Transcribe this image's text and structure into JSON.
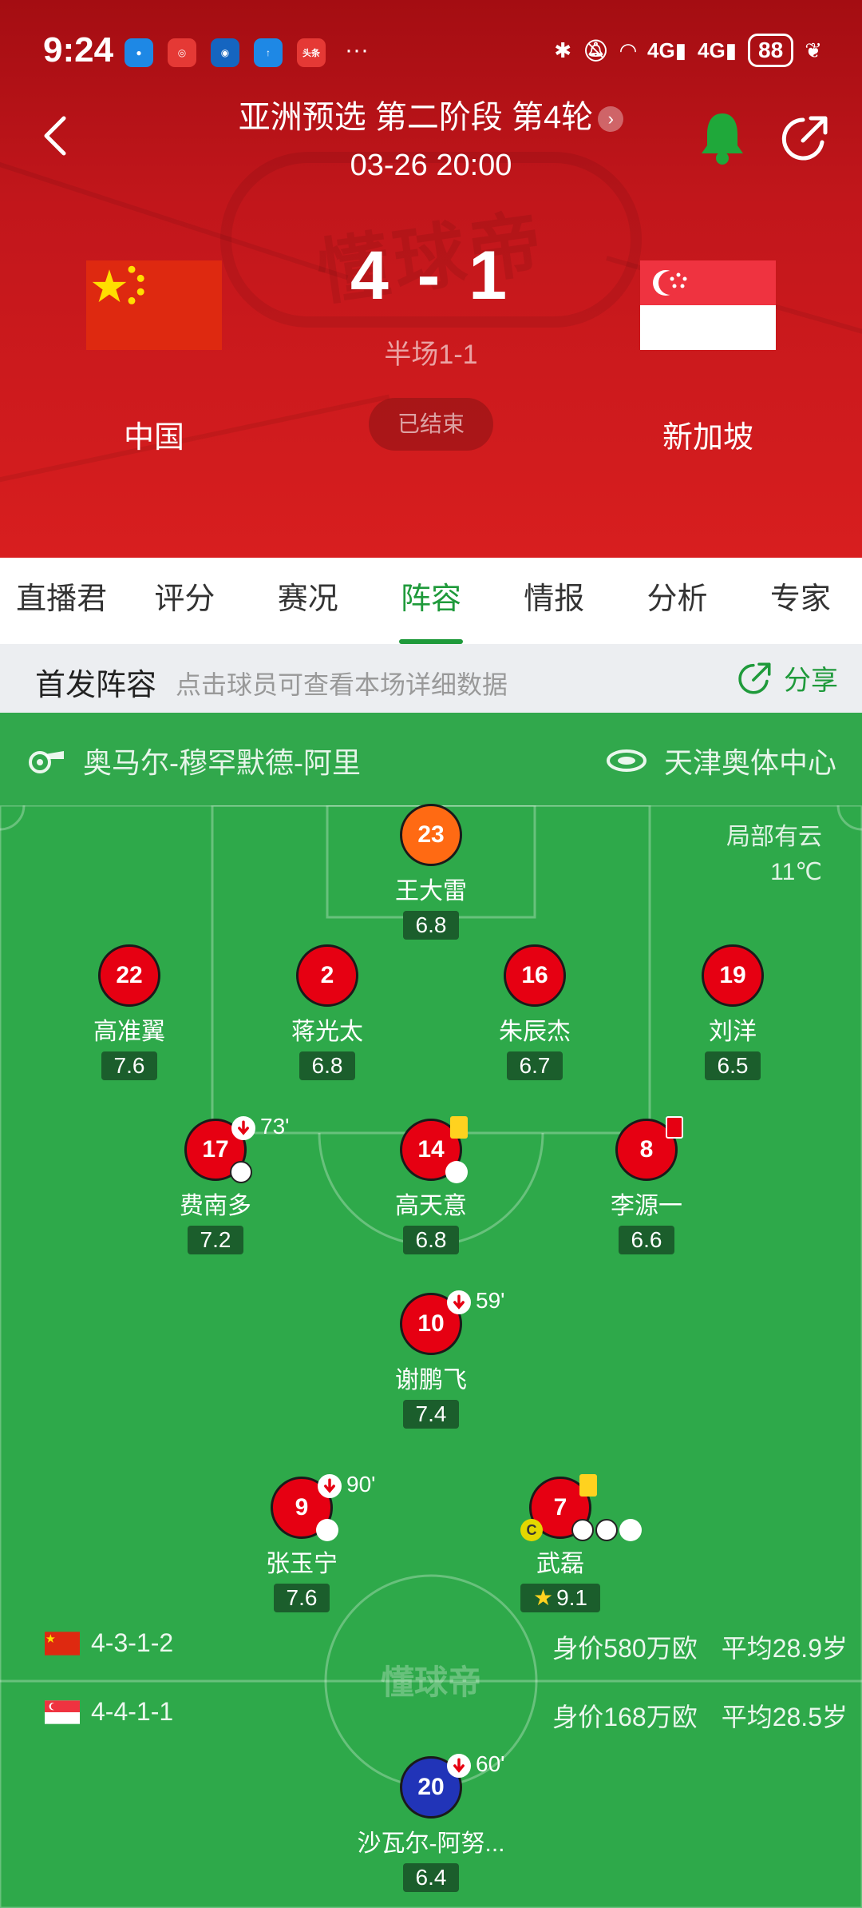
{
  "status": {
    "time": "9:24",
    "battery": "88",
    "net1": "4G",
    "net2": "4G"
  },
  "header": {
    "title": "亚洲预选 第二阶段 第4轮",
    "datetime": "03-26 20:00",
    "score": "4 - 1",
    "halftime": "半场1-1",
    "home": "中国",
    "away": "新加坡",
    "state": "已结束",
    "watermark": "懂球帝"
  },
  "tabs": [
    "直播君",
    "评分",
    "赛况",
    "阵容",
    "情报",
    "分析",
    "专家"
  ],
  "lineup": {
    "title": "首发阵容",
    "hint": "点击球员可查看本场详细数据",
    "share": "分享",
    "referee": "奥马尔-穆罕默德-阿里",
    "venue": "天津奥体中心",
    "weather": "局部有云",
    "temp": "11℃",
    "watermark": "懂球帝"
  },
  "players": {
    "gk": {
      "num": "23",
      "name": "王大雷",
      "rating": "6.8"
    },
    "d1": {
      "num": "22",
      "name": "高准翼",
      "rating": "7.6"
    },
    "d2": {
      "num": "2",
      "name": "蒋光太",
      "rating": "6.8"
    },
    "d3": {
      "num": "16",
      "name": "朱辰杰",
      "rating": "6.7"
    },
    "d4": {
      "num": "19",
      "name": "刘洋",
      "rating": "6.5"
    },
    "m1": {
      "num": "17",
      "name": "费南多",
      "rating": "7.2",
      "sub": "73'"
    },
    "m2": {
      "num": "14",
      "name": "高天意",
      "rating": "6.8"
    },
    "m3": {
      "num": "8",
      "name": "李源一",
      "rating": "6.6"
    },
    "am": {
      "num": "10",
      "name": "谢鹏飞",
      "rating": "7.4",
      "sub": "59'"
    },
    "f1": {
      "num": "9",
      "name": "张玉宁",
      "rating": "7.6",
      "sub": "90'"
    },
    "f2": {
      "num": "7",
      "name": "武磊",
      "rating": "9.1"
    },
    "sg1": {
      "num": "20",
      "name": "沙瓦尔-阿努...",
      "rating": "6.4",
      "sub": "60'"
    }
  },
  "formations": {
    "home": {
      "form": "4-3-1-2",
      "value": "身价580万欧",
      "age": "平均28.9岁"
    },
    "away": {
      "form": "4-4-1-1",
      "value": "身价168万欧",
      "age": "平均28.5岁"
    }
  },
  "colors": {
    "accent": "#1f9a3b",
    "header": "#c1161b",
    "pitch": "#2ea94a"
  }
}
